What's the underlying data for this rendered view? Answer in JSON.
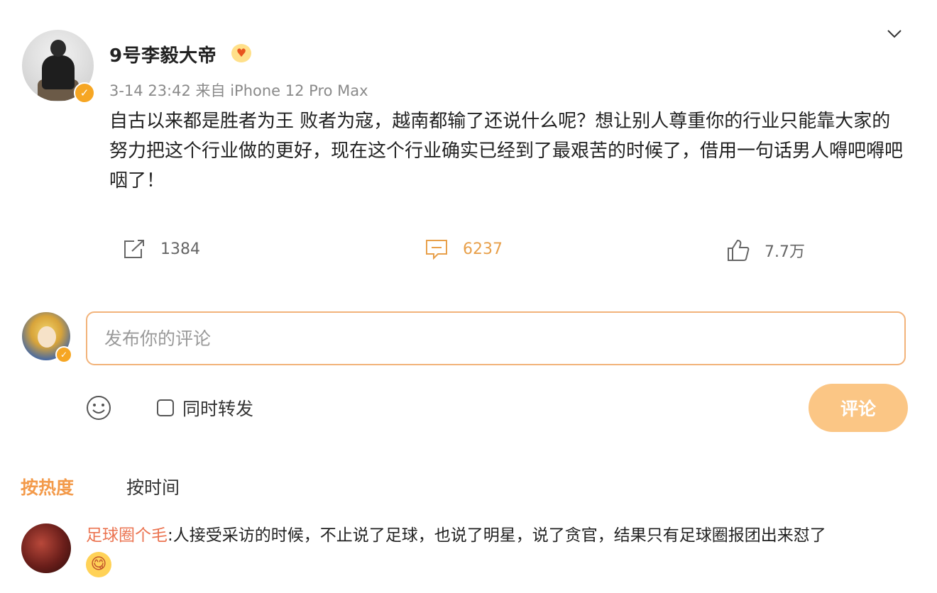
{
  "post": {
    "username": "9号李毅大帝",
    "vip_badge_glyph": "♥",
    "verified_glyph": "✓",
    "meta": "3-14 23:42 来自 iPhone 12 Pro Max",
    "text": "自古以来都是胜者为王 败者为寇，越南都输了还说什么呢？想让别人尊重你的行业只能靠大家的努力把这个行业做的更好，现在这个行业确实已经到了最艰苦的时候了，借用一句话男人嘚吧嘚吧咽了！",
    "icons": [
      "chevron-down-icon",
      "repost-icon",
      "comment-icon",
      "like-icon"
    ]
  },
  "actions": {
    "repost_count": "1384",
    "comment_count": "6237",
    "like_count": "7.7万"
  },
  "composer": {
    "placeholder": "发布你的评论",
    "repost_label": "同时转发",
    "submit_label": "评论",
    "verified_glyph": "✓"
  },
  "sort_tabs": {
    "hot": "按热度",
    "time": "按时间"
  },
  "colors": {
    "accent_orange": "#f39a4a",
    "submit_bg": "#fbc685",
    "verified_gold": "#f6a623",
    "author_link": "#eb7350"
  },
  "comments": [
    {
      "author": "足球圈个毛",
      "separator": ":",
      "text": "人接受采访的时候，不止说了足球，也说了明星，说了贪官，结果只有足球圈报团出来怼了",
      "emoji": "😋"
    }
  ]
}
